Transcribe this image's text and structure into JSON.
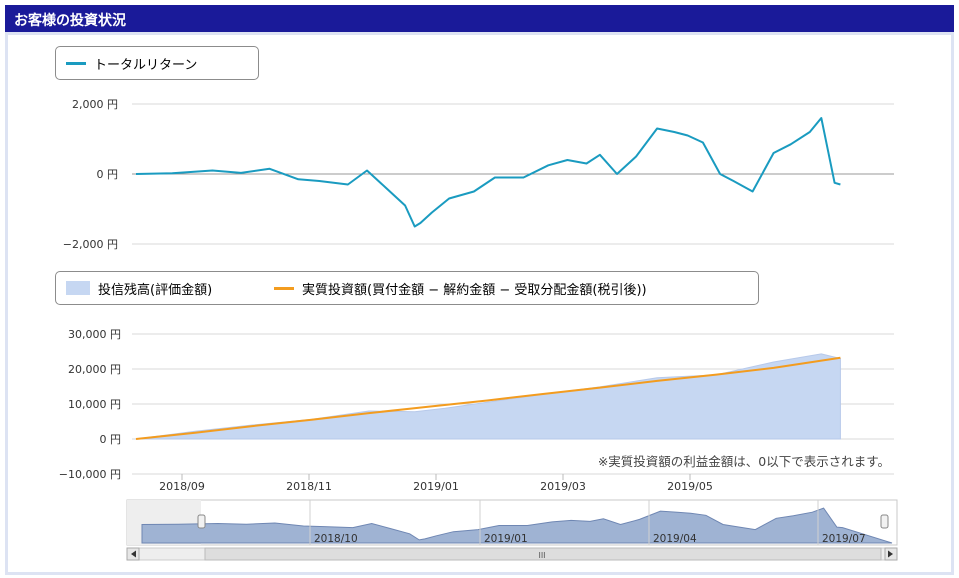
{
  "header": {
    "title": "お客様の投資状況"
  },
  "legend_top": {
    "total_return": "トータルリターン"
  },
  "legend_bottom": {
    "balance": "投信残高(評価金額)",
    "invested": "実質投資額(買付金額 − 解約金額 − 受取分配金額(税引後))"
  },
  "note": "※実質投資額の利益金額は、0以下で表示されます。",
  "colors": {
    "header_bg": "#1a1a99",
    "return_line": "#1a9bc0",
    "balance_fill": "#c6d7f2",
    "invested_line": "#f39c1f",
    "navigator_fill": "#9fb3d3"
  },
  "navigator": {
    "labels": [
      "2018/10",
      "2019/01",
      "2019/04",
      "2019/07"
    ],
    "scroll_grip": "III"
  },
  "chart_data": [
    {
      "type": "line",
      "x_range": [
        "2018-08-01",
        "2019-08-31"
      ],
      "x_ticks": [
        "2018/09",
        "2018/11",
        "2019/01",
        "2019/03",
        "2019/05"
      ],
      "y_ticks": [
        "2,000 円",
        "0 円",
        "−2,000 円"
      ],
      "ylim": [
        -2000,
        2000
      ],
      "series": [
        {
          "name": "トータルリターン",
          "x": [
            "2018-08-01",
            "2018-08-20",
            "2018-09-10",
            "2018-09-25",
            "2018-10-10",
            "2018-10-25",
            "2018-11-05",
            "2018-11-20",
            "2018-11-30",
            "2018-12-10",
            "2018-12-20",
            "2018-12-25",
            "2018-12-28",
            "2019-01-03",
            "2019-01-12",
            "2019-01-25",
            "2019-02-05",
            "2019-02-20",
            "2019-03-05",
            "2019-03-15",
            "2019-03-25",
            "2019-04-01",
            "2019-04-10",
            "2019-04-20",
            "2019-05-01",
            "2019-05-10",
            "2019-05-17",
            "2019-05-25",
            "2019-06-03",
            "2019-06-10",
            "2019-06-20",
            "2019-07-01",
            "2019-07-10",
            "2019-07-20",
            "2019-07-26",
            "2019-08-02",
            "2019-08-05"
          ],
          "values": [
            0,
            20,
            100,
            30,
            150,
            -150,
            -200,
            -300,
            100,
            -400,
            -900,
            -1500,
            -1400,
            -1100,
            -700,
            -500,
            -100,
            -100,
            250,
            400,
            300,
            550,
            0,
            500,
            1300,
            1200,
            1100,
            900,
            0,
            -200,
            -500,
            600,
            850,
            1200,
            1600,
            -250,
            -300
          ]
        }
      ]
    },
    {
      "type": "area",
      "x_range": [
        "2018-08-01",
        "2019-08-31"
      ],
      "y_ticks": [
        "30,000 円",
        "20,000 円",
        "10,000 円",
        "0 円",
        "−10,000 円"
      ],
      "ylim": [
        -10000,
        30000
      ],
      "series": [
        {
          "name": "投信残高(評価金額)",
          "x": [
            "2018-08-01",
            "2018-09-01",
            "2018-10-01",
            "2018-11-01",
            "2018-12-01",
            "2018-12-25",
            "2019-01-10",
            "2019-02-01",
            "2019-03-01",
            "2019-04-01",
            "2019-05-01",
            "2019-06-01",
            "2019-07-01",
            "2019-07-26",
            "2019-08-05"
          ],
          "values": [
            0,
            2200,
            4000,
            5600,
            8000,
            7800,
            8800,
            10500,
            12700,
            14900,
            17500,
            18300,
            22000,
            24300,
            23000
          ]
        },
        {
          "name": "実質投資額(買付金額 − 解約金額 − 受取分配金額(税引後))",
          "x": [
            "2018-08-01",
            "2018-09-01",
            "2018-10-01",
            "2018-11-01",
            "2018-12-01",
            "2019-01-01",
            "2019-02-01",
            "2019-03-01",
            "2019-04-01",
            "2019-05-01",
            "2019-06-01",
            "2019-07-01",
            "2019-08-05"
          ],
          "values": [
            0,
            1800,
            3700,
            5500,
            7400,
            9200,
            11000,
            12800,
            14700,
            16600,
            18400,
            20300,
            23200
          ]
        }
      ]
    }
  ]
}
